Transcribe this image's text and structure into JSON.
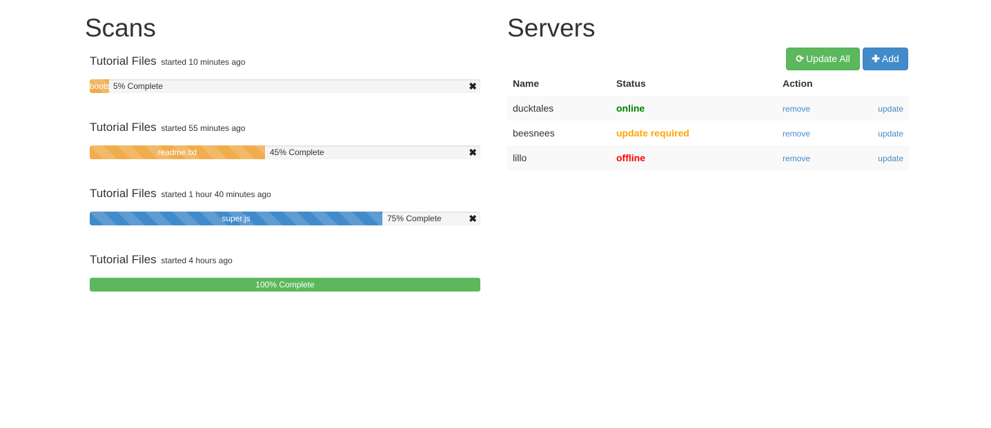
{
  "scans_heading": "Scans",
  "servers_heading": "Servers",
  "scans": [
    {
      "title": "Tutorial Files",
      "started": "started 10 minutes ago",
      "file": "boots",
      "progress_text": "5% Complete",
      "progress_percent": 5,
      "color": "#f0ad4e",
      "close_icon": "close-icon"
    },
    {
      "title": "Tutorial Files",
      "started": "started 55 minutes ago",
      "file": "readme.txt",
      "progress_text": "45% Complete",
      "progress_percent": 45,
      "color": "#f0ad4e",
      "close_icon": "close-icon"
    },
    {
      "title": "Tutorial Files",
      "started": "started 1 hour 40 minutes ago",
      "file": "super.js",
      "progress_text": "75% Complete",
      "progress_percent": 75,
      "color": "#428bca",
      "close_icon": "close-icon"
    },
    {
      "title": "Tutorial Files",
      "started": "started 4 hours ago",
      "progress_text": "100% Complete",
      "progress_percent": 100,
      "color": "#5cb85c"
    }
  ],
  "toolbar": {
    "update_all_label": "Update All",
    "update_all_icon": "refresh-icon",
    "add_label": "Add",
    "add_icon": "plus-icon"
  },
  "servers_table": {
    "headers": [
      "Name",
      "Status",
      "Action"
    ],
    "rows": [
      {
        "name": "ducktales",
        "status": "online",
        "status_color": "#008000",
        "remove": "remove",
        "update": "update"
      },
      {
        "name": "beesnees",
        "status": "update required",
        "status_color": "#ffa500",
        "remove": "remove",
        "update": "update"
      },
      {
        "name": "lillo",
        "status": "offline",
        "status_color": "#ff0000",
        "remove": "remove",
        "update": "update"
      }
    ]
  }
}
